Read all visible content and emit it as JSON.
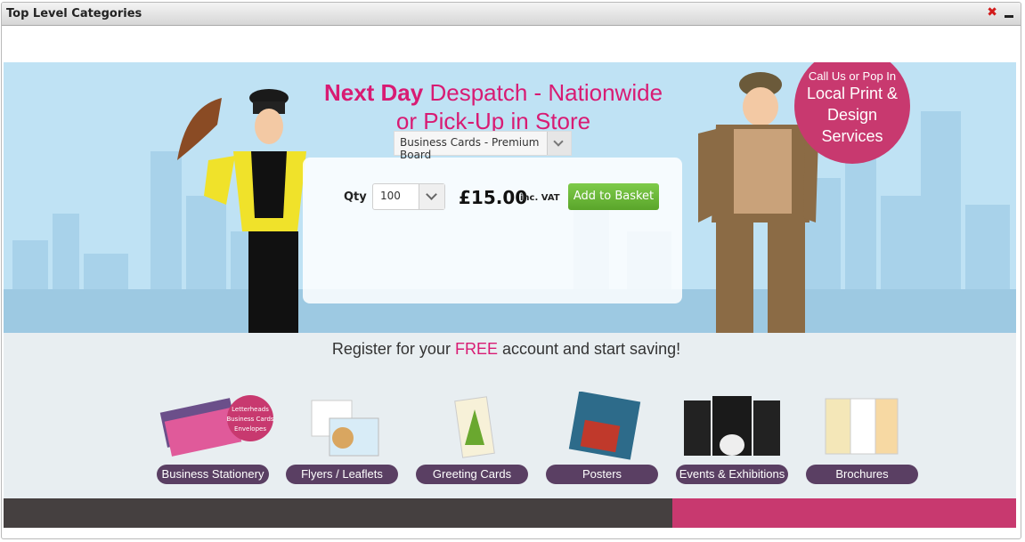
{
  "panel": {
    "title": "Top Level Categories"
  },
  "banner": {
    "headline_bold": "Next Day",
    "headline_rest": " Despatch - Nationwide",
    "headline_line2": "or Pick-Up in Store",
    "product_select": "Business Cards - Premium Board",
    "qty_label": "Qty",
    "qty_value": "100",
    "price": "£15.00",
    "inc_vat": "inc. VAT",
    "add_to_basket": "Add to Basket",
    "call_top": "Call Us or Pop In",
    "call_line1": "Local Print &",
    "call_line2": "Design",
    "call_line3": "Services"
  },
  "register": {
    "before": "Register for your ",
    "free": "FREE",
    "after": " account and start saving!"
  },
  "categories": [
    {
      "label": "Business Stationery"
    },
    {
      "label": "Flyers / Leaflets"
    },
    {
      "label": "Greeting Cards"
    },
    {
      "label": "Posters"
    },
    {
      "label": "Events & Exhibitions"
    },
    {
      "label": "Brochures"
    }
  ],
  "stationery_badge": [
    "Letterheads",
    "Business Cards",
    "Envelopes"
  ],
  "colors": {
    "pink": "#c8396f",
    "headline": "#d81b73",
    "button_green": "#6cba3a",
    "category_purple": "#5a3f63",
    "footer_dark": "#454040"
  }
}
